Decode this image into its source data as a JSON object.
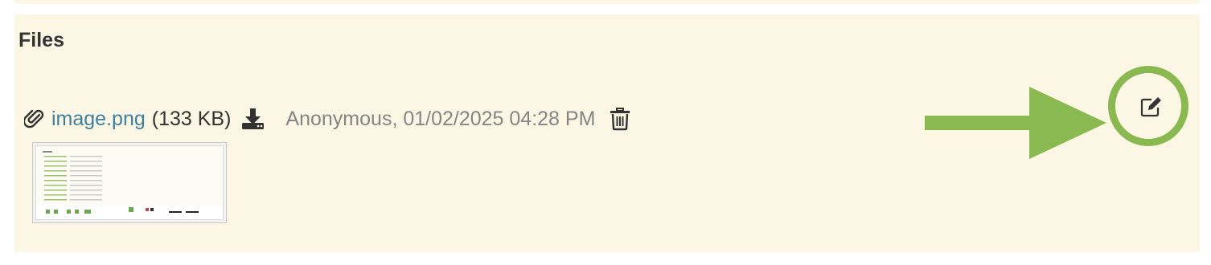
{
  "section": {
    "title": "Files"
  },
  "file": {
    "name": "image.png",
    "size": "(133 KB)",
    "meta": "Anonymous, 01/02/2025 04:28 PM"
  },
  "icons": {
    "attachment": "paperclip-icon",
    "download": "download-icon",
    "delete": "trash-icon",
    "edit": "edit-icon",
    "annotation": "arrow-annotation"
  },
  "colors": {
    "panel_bg": "#fcf7e4",
    "link": "#3f7f9e",
    "meta_text": "#858585",
    "annotation": "#8bb951"
  }
}
